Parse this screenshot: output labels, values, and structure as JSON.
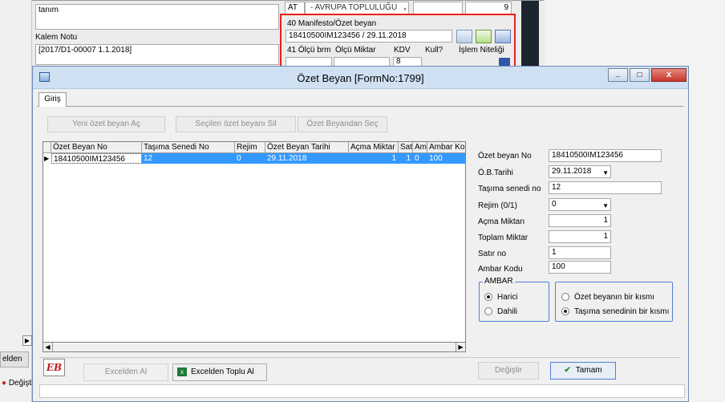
{
  "background_form": {
    "tanim_label": "tanım",
    "at_code": "AT",
    "at_select": "- AVRUPA TOPLULUĞU",
    "count_value": "9",
    "manifesto_label": "40 Manifesto/Özet beyan",
    "manifesto_value": "18410500IM123456 / 29.11.2018",
    "kalem_notu_label": "Kalem Notu",
    "kalem_notu_value": "[2017/D1-00007 1.1.2018]",
    "olcu_birim_label": "41 Ölçü brm",
    "olcu_miktar_label": "Ölçü Miktar",
    "kdv_label": "KDV",
    "kull_label": "Kull?",
    "islem_label": "İşlem Niteliği",
    "partial_value": "8",
    "left_excelden_label": "elden",
    "left_degistir_label": "Değişti",
    "annotation_color": "#e8201c"
  },
  "dialog": {
    "title": "Özet Beyan [FormNo:1799]",
    "minimize_symbol": "_",
    "maximize_symbol": "□",
    "close_symbol": "x",
    "tab_label": "Giriş",
    "toolbar": {
      "new_label": "Yeni özet beyan Aç",
      "delete_label": "Seçilen özet beyanı Sil",
      "select_label": "Özet Beyandan Seç"
    },
    "grid": {
      "columns": [
        "Özet Beyan No",
        "Taşıma Senedi No",
        "Rejim",
        "Özet Beyan Tarihi",
        "Açma Miktar",
        "Sat",
        "Am",
        "Ambar Ko"
      ],
      "rows": [
        [
          "18410500IM123456",
          "12",
          "0",
          "29.11.2018",
          "1",
          "1",
          "0",
          "100"
        ]
      ]
    },
    "details": {
      "ozet_no_label": "Özet beyan No",
      "ozet_no_value": "18410500IM123456",
      "ob_tarihi_label": "Ö.B.Tarihi",
      "ob_tarihi_value": "29.11.2018",
      "tasima_label": "Taşıma senedi no",
      "tasima_value": "12",
      "rejim_label": "Rejim  (0/1)",
      "rejim_value": "0",
      "acma_label": "Açma Miktarı",
      "acma_value": "1",
      "toplam_label": "Toplam Miktar",
      "toplam_value": "1",
      "satir_label": "Satır no",
      "satir_value": "1",
      "ambar_kodu_label": "Ambar Kodu",
      "ambar_kodu_value": "100",
      "ambar_group_label": "AMBAR",
      "harici_label": "Harici",
      "dahili_label": "Dahili",
      "ozet_kismi_label": "Özet beyanın bir kısmı",
      "tasima_kismi_label": "Taşıma senedinin bir kısmı"
    },
    "footer": {
      "logo_text": "EB",
      "excelden_al_label": "Excelden Al",
      "excelden_toplu_label": "Excelden Toplu Al",
      "degistir_label": "Değiştir",
      "tamam_label": "Tamam"
    },
    "title_bar_color": "#cfe0f3",
    "selected_row_color": "#3399ff",
    "close_button_color": "#c8352b"
  }
}
